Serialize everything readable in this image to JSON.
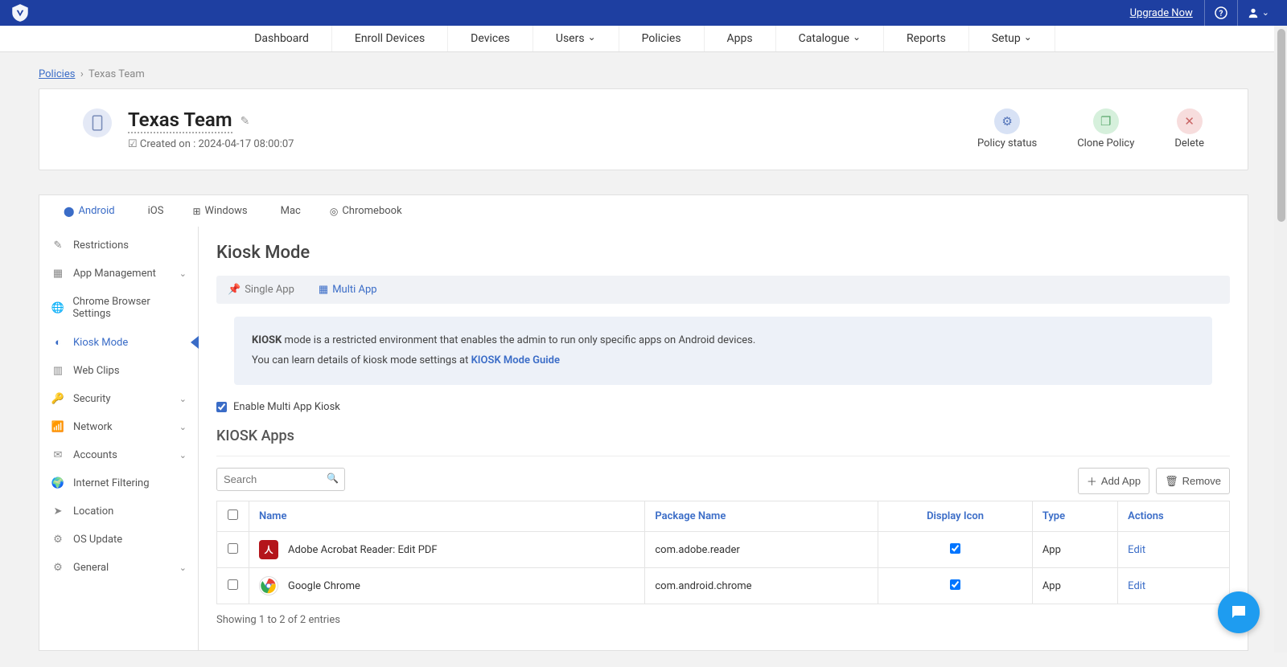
{
  "topbar": {
    "upgrade": "Upgrade Now"
  },
  "mainnav": [
    "Dashboard",
    "Enroll Devices",
    "Devices",
    "Users",
    "Policies",
    "Apps",
    "Catalogue",
    "Reports",
    "Setup"
  ],
  "breadcrumb": {
    "root": "Policies",
    "current": "Texas Team"
  },
  "policy": {
    "title": "Texas Team",
    "created": "Created on : 2024-04-17 08:00:07",
    "actions": {
      "status": "Policy status",
      "clone": "Clone Policy",
      "delete": "Delete"
    }
  },
  "ostabs": [
    "Android",
    "iOS",
    "Windows",
    "Mac",
    "Chromebook"
  ],
  "sidebar": [
    {
      "icon": "✎",
      "label": "Restrictions"
    },
    {
      "icon": "▦",
      "label": "App Management",
      "chev": true
    },
    {
      "icon": "🌐",
      "label": "Chrome Browser Settings"
    },
    {
      "icon": "◐",
      "label": "Kiosk Mode",
      "active": true
    },
    {
      "icon": "▥",
      "label": "Web Clips"
    },
    {
      "icon": "🔑",
      "label": "Security",
      "chev": true
    },
    {
      "icon": "📶",
      "label": "Network",
      "chev": true
    },
    {
      "icon": "✉",
      "label": "Accounts",
      "chev": true
    },
    {
      "icon": "🌍",
      "label": "Internet Filtering"
    },
    {
      "icon": "➤",
      "label": "Location"
    },
    {
      "icon": "⚙",
      "label": "OS Update"
    },
    {
      "icon": "⚙",
      "label": "General",
      "chev": true
    }
  ],
  "content": {
    "heading": "Kiosk Mode",
    "subtabs": {
      "single": "Single App",
      "multi": "Multi App"
    },
    "info_bold": "KIOSK",
    "info_text1": " mode is a restricted environment that enables the admin to run only specific apps on Android devices.",
    "info_text2": "You can learn details of kiosk mode settings at ",
    "info_link": "KIOSK Mode Guide",
    "enable_label": "Enable Multi App Kiosk",
    "apps_heading": "KIOSK Apps",
    "search_placeholder": "Search",
    "add_btn": "Add App",
    "remove_btn": "Remove",
    "cols": {
      "name": "Name",
      "pkg": "Package Name",
      "disp": "Display Icon",
      "type": "Type",
      "act": "Actions"
    },
    "rows": [
      {
        "name": "Adobe Acrobat Reader: Edit PDF",
        "pkg": "com.adobe.reader",
        "type": "App",
        "edit": "Edit",
        "iconcls": "ic-pdf",
        "iconchar": "A"
      },
      {
        "name": "Google Chrome",
        "pkg": "com.android.chrome",
        "type": "App",
        "edit": "Edit",
        "iconcls": "ic-chrome",
        "iconchar": ""
      }
    ],
    "showing": "Showing 1 to 2 of 2 entries"
  }
}
